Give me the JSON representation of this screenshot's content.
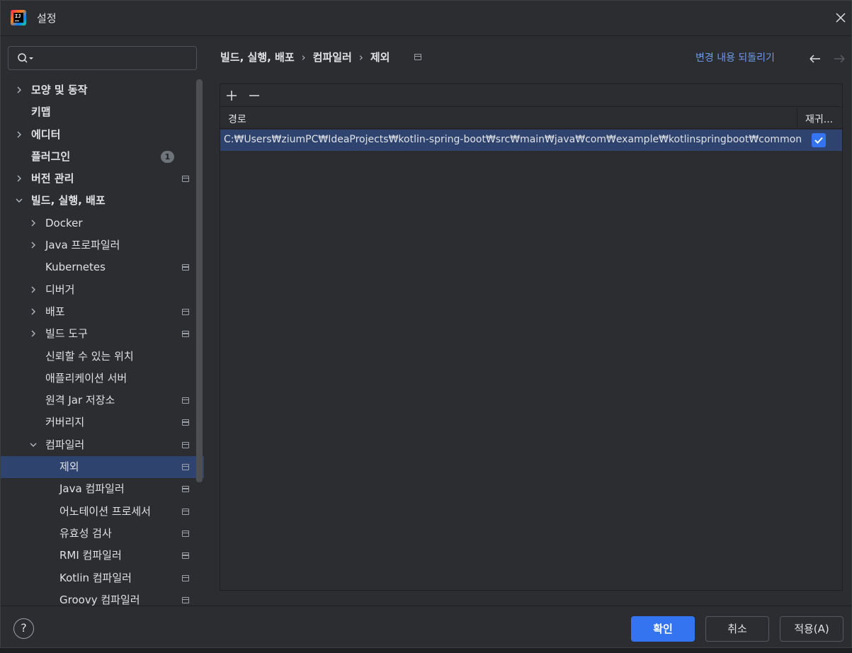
{
  "window": {
    "title": "설정"
  },
  "search": {
    "placeholder": ""
  },
  "sidebar": {
    "items": [
      {
        "label": "모양 및 동작",
        "depth": 0,
        "expander": "collapsed",
        "bold": true,
        "project": false
      },
      {
        "label": "키맵",
        "depth": 0,
        "expander": "none",
        "bold": true,
        "project": false
      },
      {
        "label": "에디터",
        "depth": 0,
        "expander": "collapsed",
        "bold": true,
        "project": false
      },
      {
        "label": "플러그인",
        "depth": 0,
        "expander": "none",
        "bold": true,
        "project": false,
        "badge": "1"
      },
      {
        "label": "버전 관리",
        "depth": 0,
        "expander": "collapsed",
        "bold": true,
        "project": true
      },
      {
        "label": "빌드, 실행, 배포",
        "depth": 0,
        "expander": "expanded",
        "bold": true,
        "project": false
      },
      {
        "label": "Docker",
        "depth": 1,
        "expander": "collapsed",
        "bold": false,
        "project": false
      },
      {
        "label": "Java 프로파일러",
        "depth": 1,
        "expander": "collapsed",
        "bold": false,
        "project": false
      },
      {
        "label": "Kubernetes",
        "depth": 1,
        "expander": "none",
        "bold": false,
        "project": true
      },
      {
        "label": "디버거",
        "depth": 1,
        "expander": "collapsed",
        "bold": false,
        "project": false
      },
      {
        "label": "배포",
        "depth": 1,
        "expander": "collapsed",
        "bold": false,
        "project": true
      },
      {
        "label": "빌드 도구",
        "depth": 1,
        "expander": "collapsed",
        "bold": false,
        "project": true
      },
      {
        "label": "신뢰할 수 있는 위치",
        "depth": 1,
        "expander": "none",
        "bold": false,
        "project": false
      },
      {
        "label": "애플리케이션 서버",
        "depth": 1,
        "expander": "none",
        "bold": false,
        "project": false
      },
      {
        "label": "원격 Jar 저장소",
        "depth": 1,
        "expander": "none",
        "bold": false,
        "project": true
      },
      {
        "label": "커버리지",
        "depth": 1,
        "expander": "none",
        "bold": false,
        "project": true
      },
      {
        "label": "컴파일러",
        "depth": 1,
        "expander": "expanded",
        "bold": false,
        "project": true
      },
      {
        "label": "제외",
        "depth": 2,
        "expander": "none",
        "bold": false,
        "project": true,
        "selected": true
      },
      {
        "label": "Java 컴파일러",
        "depth": 2,
        "expander": "none",
        "bold": false,
        "project": true
      },
      {
        "label": "어노테이션 프로세서",
        "depth": 2,
        "expander": "none",
        "bold": false,
        "project": true
      },
      {
        "label": "유효성 검사",
        "depth": 2,
        "expander": "none",
        "bold": false,
        "project": true
      },
      {
        "label": "RMI 컴파일러",
        "depth": 2,
        "expander": "none",
        "bold": false,
        "project": true
      },
      {
        "label": "Kotlin 컴파일러",
        "depth": 2,
        "expander": "none",
        "bold": false,
        "project": true
      },
      {
        "label": "Groovy 컴파일러",
        "depth": 2,
        "expander": "none",
        "bold": false,
        "project": true
      }
    ]
  },
  "breadcrumb": {
    "part1": "빌드, 실행, 배포",
    "sep": "›",
    "part2": "컴파일러",
    "part3": "제외"
  },
  "header": {
    "reset_label": "변경 내용 되돌리기"
  },
  "table": {
    "columns": {
      "path": "경로",
      "recursive": "재귀..."
    },
    "rows": [
      {
        "path": "C:₩Users₩ziumPC₩IdeaProjects₩kotlin-spring-boot₩src₩main₩java₩com₩example₩kotlinspringboot₩common",
        "recursive": true
      }
    ]
  },
  "footer": {
    "help": "?",
    "ok_label": "확인",
    "cancel_label": "취소",
    "apply_label": "적용(A)"
  },
  "colors": {
    "accent": "#3574f0",
    "selection": "#2e436e",
    "link": "#6c9ce8",
    "background": "#2b2d30"
  }
}
